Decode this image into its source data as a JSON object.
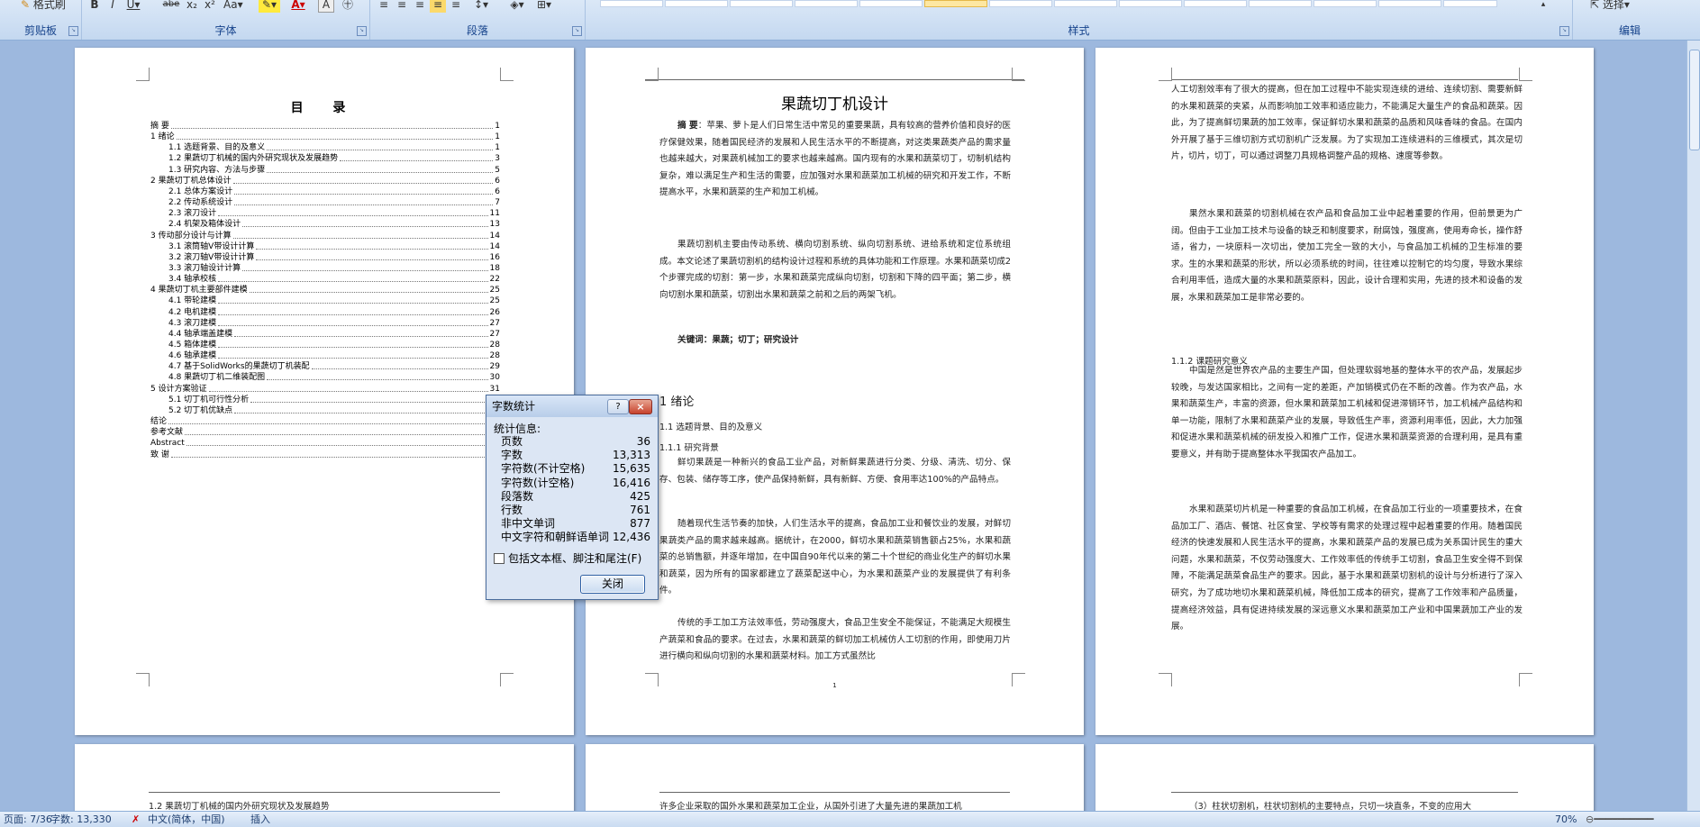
{
  "ribbon": {
    "groups": {
      "clipboard": "剪贴板",
      "font": "字体",
      "paragraph": "段落",
      "styles": "样式",
      "editing": "编辑"
    },
    "format_painter": "格式刷",
    "select": "选择",
    "font_buttons": [
      "B",
      "I",
      "U",
      "abe",
      "x₂",
      "x²",
      "Aa",
      "A",
      "A"
    ]
  },
  "page1": {
    "title": "目 录",
    "toc": [
      {
        "text": "摘 要",
        "page": "1",
        "level": 0
      },
      {
        "text": "1 绪论",
        "page": "1",
        "level": 0
      },
      {
        "text": "1.1 选题背景、目的及意义",
        "page": "1",
        "level": 1
      },
      {
        "text": "1.2 果蔬切丁机械的国内外研究现状及发展趋势",
        "page": "3",
        "level": 1
      },
      {
        "text": "1.3 研究内容、方法与步骤",
        "page": "5",
        "level": 1
      },
      {
        "text": "2 果蔬切丁机总体设计",
        "page": "6",
        "level": 0
      },
      {
        "text": "2.1 总体方案设计",
        "page": "6",
        "level": 1
      },
      {
        "text": "2.2 传动系统设计",
        "page": "7",
        "level": 1
      },
      {
        "text": "2.3 滚刀设计",
        "page": "11",
        "level": 1
      },
      {
        "text": "2.4 机架及箱体设计",
        "page": "13",
        "level": 1
      },
      {
        "text": "3 传动部分设计与计算",
        "page": "14",
        "level": 0
      },
      {
        "text": "3.1 滚筒轴V带设计计算",
        "page": "14",
        "level": 1
      },
      {
        "text": "3.2 滚刀轴V带设计计算",
        "page": "16",
        "level": 1
      },
      {
        "text": "3.3 滚刀轴设计计算",
        "page": "18",
        "level": 1
      },
      {
        "text": "3.4 轴承校核",
        "page": "22",
        "level": 1
      },
      {
        "text": "4 果蔬切丁机主要部件建模",
        "page": "25",
        "level": 0
      },
      {
        "text": "4.1 带轮建模",
        "page": "25",
        "level": 1
      },
      {
        "text": "4.2 电机建模",
        "page": "26",
        "level": 1
      },
      {
        "text": "4.3 滚刀建模",
        "page": "27",
        "level": 1
      },
      {
        "text": "4.4 轴承端盖建模",
        "page": "27",
        "level": 1
      },
      {
        "text": "4.5 箱体建模",
        "page": "28",
        "level": 1
      },
      {
        "text": "4.6 轴承建模",
        "page": "28",
        "level": 1
      },
      {
        "text": "4.7 基于SolidWorks的果蔬切丁机装配",
        "page": "29",
        "level": 1
      },
      {
        "text": "4.8 果蔬切丁机二维装配图",
        "page": "30",
        "level": 1
      },
      {
        "text": "5 设计方案验证",
        "page": "31",
        "level": 0
      },
      {
        "text": "5.1 切丁机可行性分析",
        "page": "31",
        "level": 1
      },
      {
        "text": "5.2 切丁机优缺点",
        "page": "31",
        "level": 1
      },
      {
        "text": "结论",
        "page": "32",
        "level": 0
      },
      {
        "text": "参考文献",
        "page": "33",
        "level": 0
      },
      {
        "text": "Abstract",
        "page": "34",
        "level": 0
      },
      {
        "text": "致 谢",
        "page": "35",
        "level": 0
      }
    ]
  },
  "page2": {
    "title": "果蔬切丁机设计",
    "abstract_label": "摘 要",
    "abstract_p1": "：苹果、萝卜是人们日常生活中常见的重要果蔬，具有较高的营养价值和良好的医疗保健效果，随着国民经济的发展和人民生活水平的不断提高，对这类果蔬类产品的需求量也越来越大，对果蔬机械加工的要求也越来越高。国内现有的水果和蔬菜切丁，切制机结构复杂，难以满足生产和生活的需要，应加强对水果和蔬菜加工机械的研究和开发工作，不断提高水平，水果和蔬菜的生产和加工机械。",
    "abstract_p2": "果蔬切割机主要由传动系统、横向切割系统、纵向切割系统、进给系统和定位系统组成。本文论述了果蔬切割机的结构设计过程和系统的具体功能和工作原理。水果和蔬菜切成2个步骤完成的切割：第一步，水果和蔬菜完成纵向切割，切割和下降的四平面；第二步，横向切割水果和蔬菜，切割出水果和蔬菜之前和之后的两架飞机。",
    "keywords": "关键词：果蔬；切丁；研究设计",
    "chapter": "1 绪论",
    "sec11": "1.1 选题背景、目的及意义",
    "sec111": "1.1.1 研究背景",
    "body_p1": "鲜切果蔬是一种新兴的食品工业产品，对新鲜果蔬进行分类、分级、清洗、切分、保存、包装、储存等工序，使产品保持新鲜，具有新鲜、方便、食用率达100%的产品特点。",
    "body_p2": "随着现代生活节奏的加快，人们生活水平的提高，食品加工业和餐饮业的发展，对鲜切果蔬类产品的需求越来越高。据统计，在2000，鲜切水果和蔬菜销售额占25%，水果和蔬菜的总销售额，并逐年增加，在中国自90年代以来的第二十个世纪的商业化生产的鲜切水果和蔬菜，因为所有的国家都建立了蔬菜配送中心，为水果和蔬菜产业的发展提供了有利条件。",
    "body_p3": "传统的手工加工方法效率低，劳动强度大，食品卫生安全不能保证，不能满足大规模生产蔬菜和食品的要求。在过去，水果和蔬菜的鲜切加工机械仿人工切割的作用，即使用刀片进行横向和纵向切割的水果和蔬菜材料。加工方式虽然比",
    "page_num": "1"
  },
  "page3": {
    "p1": "人工切割效率有了很大的提高，但在加工过程中不能实现连续的进给、连续切割、需要新鲜的水果和蔬菜的夹紧，从而影响加工效率和适应能力，不能满足大量生产的食品和蔬菜。因此，为了提高鲜切果蔬的加工效率，保证鲜切水果和蔬菜的品质和风味香味的食品。在国内外开展了基于三维切割方式切割机广泛发展。为了实现加工连续进料的三维模式，其次是切片，切片，切丁，可以通过调整刀具规格调整产品的规格、速度等参数。",
    "p2": "果然水果和蔬菜的切割机械在农产品和食品加工业中起着重要的作用，但前景更为广阔。但由于工业加工技术与设备的缺乏和制度要求，耐腐蚀，强度高，使用寿命长，操作舒适，省力，一块原料一次切出，使加工完全一致的大小，与食品加工机械的卫生标准的要求。生的水果和蔬菜的形状，所以必须系统的时间，往往难以控制它的均匀度，导致水果综合利用率低，造成大量的水果和蔬菜原料，因此，设计合理和实用，先进的技术和设备的发展，水果和蔬菜加工是非常必要的。",
    "sec112": "1.1.2 课题研究意义",
    "p3": "中国是然是世界农产品的主要生产国，但处理软弱地基的整体水平的农产品，发展起步较晚，与发达国家相比，之间有一定的差距，产加销模式仍在不断的改善。作为农产品，水果和蔬菜生产，丰富的资源，但水果和蔬菜加工机械和促进滞销环节，加工机械产品结构和单一功能，限制了水果和蔬菜产业的发展，导致低生产率，资源利用率低，因此，大力加强和促进水果和蔬菜机械的研发投入和推广工作，促进水果和蔬菜资源的合理利用，是具有重要意义，并有助于提高整体水平我国农产品加工。",
    "p4": "水果和蔬菜切片机是一种重要的食品加工机械，在食品加工行业的一项重要技术，在食品加工厂、酒店、餐馆、社区食堂、学校等有需求的处理过程中起着重要的作用。随着国民经济的快速发展和人民生活水平的提高，水果和蔬菜产品的发展已成为关系国计民生的重大问题，水果和蔬菜，不仅劳动强度大、工作效率低的传统手工切割，食品卫生安全得不到保障，不能满足蔬菜食品生产的要求。因此，基于水果和蔬菜切割机的设计与分析进行了深入研究，为了成功地切水果和蔬菜机械，降低加工成本的研究，提高了工作效率和产品质量，提高经济效益，具有促进持续发展的深远意义水果和蔬菜加工产业和中国果蔬加工产业的发展。"
  },
  "page4": {
    "text": "1.2 果蔬切丁机械的国内外研究现状及发展趋势"
  },
  "page5": {
    "text": "许多企业采取的国外水果和蔬菜加工企业，从国外引进了大量先进的果蔬加工机"
  },
  "page6": {
    "text": "（3）柱状切割机，柱状切割机的主要特点，只切一块直条，不变的应用大"
  },
  "dialog": {
    "title": "字数统计",
    "help": "?",
    "close": "×",
    "section": "统计信息:",
    "rows": [
      {
        "label": "页数",
        "value": "36"
      },
      {
        "label": "字数",
        "value": "13,313"
      },
      {
        "label": "字符数(不计空格)",
        "value": "15,635"
      },
      {
        "label": "字符数(计空格)",
        "value": "16,416"
      },
      {
        "label": "段落数",
        "value": "425"
      },
      {
        "label": "行数",
        "value": "761"
      },
      {
        "label": "非中文单词",
        "value": "877"
      },
      {
        "label": "中文字符和朝鲜语单词",
        "value": "12,436"
      }
    ],
    "checkbox": "包括文本框、脚注和尾注(F)",
    "button": "关闭"
  },
  "status": {
    "page": "页面: 7/36",
    "words": "字数: 13,330",
    "lang": "中文(简体，中国)",
    "mode": "插入",
    "zoom": "70%"
  }
}
